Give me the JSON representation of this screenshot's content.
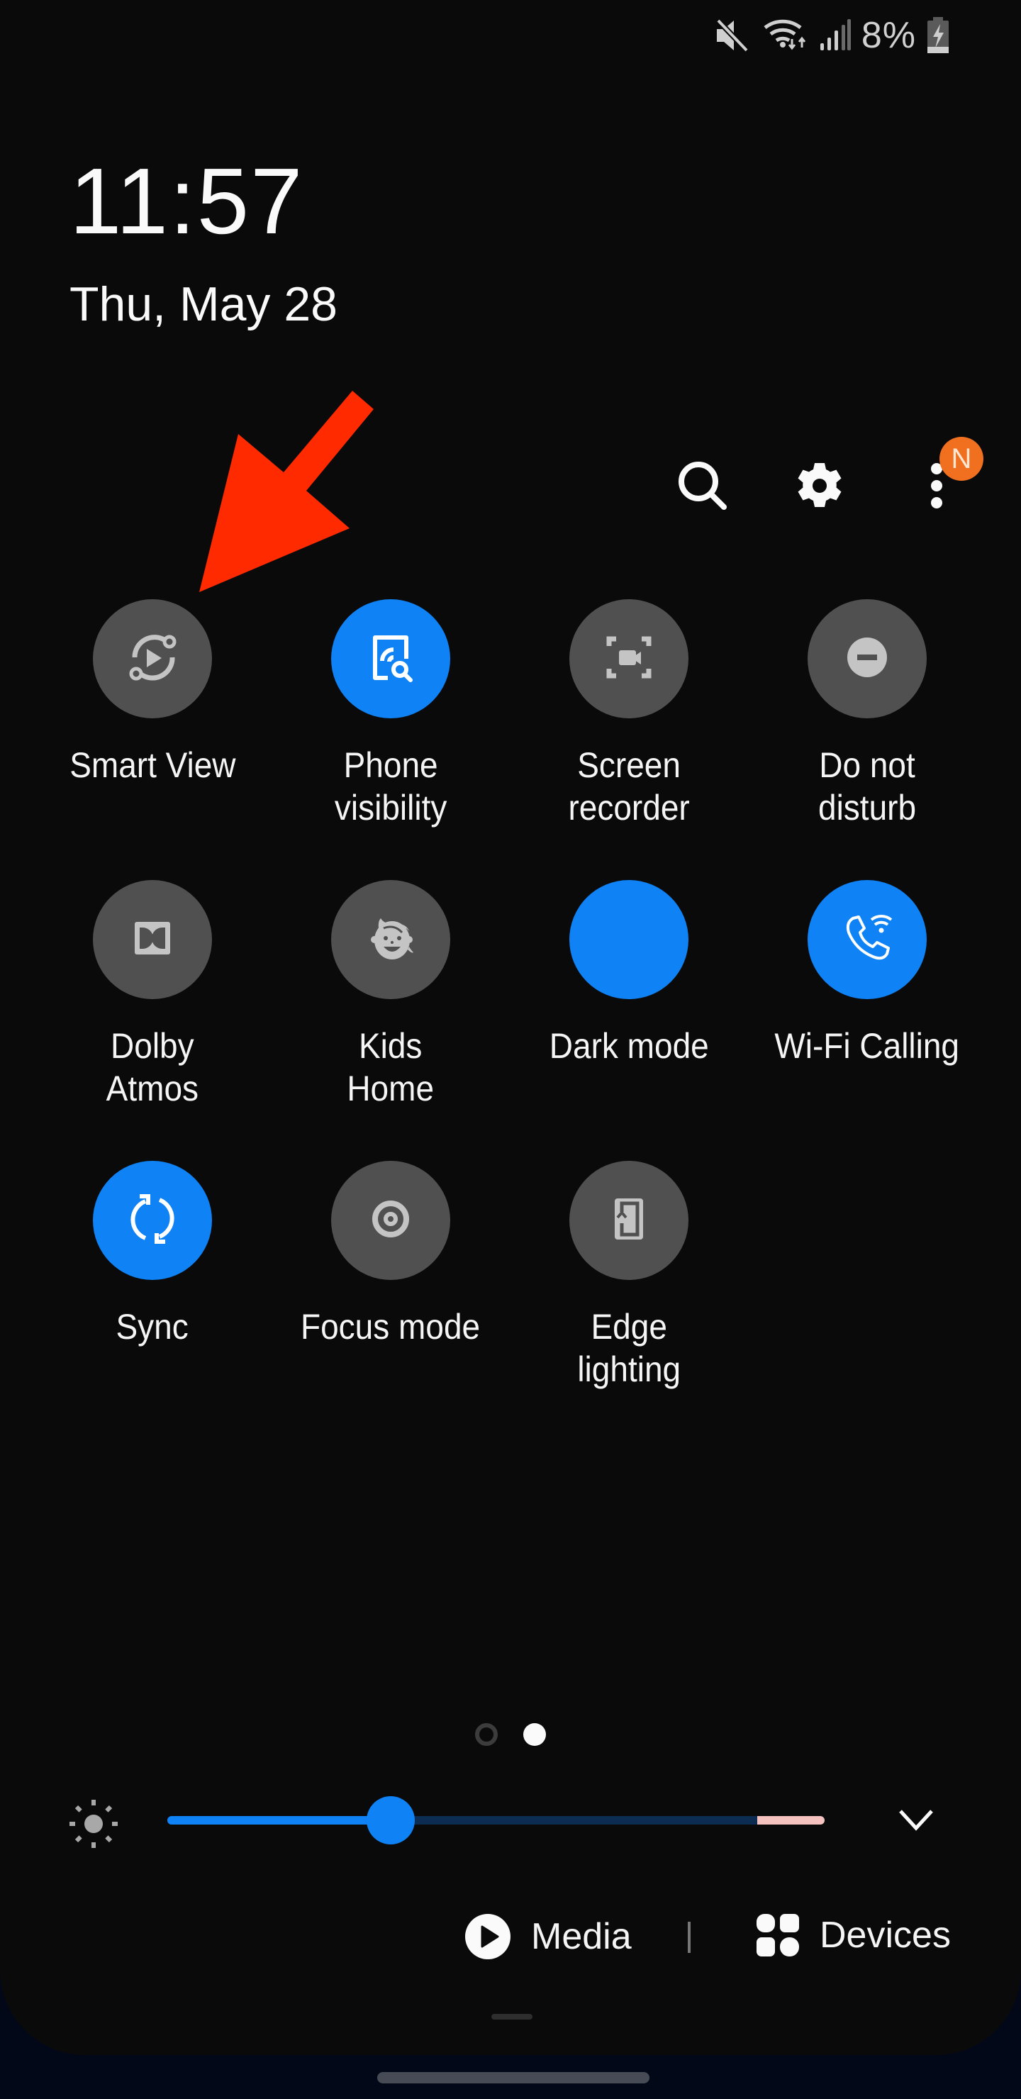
{
  "status_bar": {
    "icons": [
      "mute-icon",
      "wifi-data-icon",
      "cell-signal-icon",
      "battery-charging-icon"
    ],
    "battery_percent": "8%"
  },
  "clock": {
    "time": "11:57",
    "date": "Thu, May 28"
  },
  "top_actions": {
    "search_icon": "search-icon",
    "settings_icon": "gear-icon",
    "more_icon": "more-vertical-icon",
    "notification_badge": "N"
  },
  "annotation": {
    "type": "arrow",
    "color": "#ff2a00",
    "points_to": "Smart View"
  },
  "quick_tiles": [
    {
      "label": "Smart View",
      "icon": "smart-view-icon",
      "active": false
    },
    {
      "label": "Phone\nvisibility",
      "icon": "phone-visibility-icon",
      "active": true
    },
    {
      "label": "Screen\nrecorder",
      "icon": "screen-recorder-icon",
      "active": false
    },
    {
      "label": "Do not\ndisturb",
      "icon": "do-not-disturb-icon",
      "active": false
    },
    {
      "label": "Dolby\nAtmos",
      "icon": "dolby-icon",
      "active": false
    },
    {
      "label": "Kids\nHome",
      "icon": "kids-face-icon",
      "active": false
    },
    {
      "label": "Dark mode",
      "icon": "moon-icon",
      "active": true
    },
    {
      "label": "Wi-Fi Calling",
      "icon": "wifi-calling-icon",
      "active": true
    },
    {
      "label": "Sync",
      "icon": "sync-icon",
      "active": true
    },
    {
      "label": "Focus mode",
      "icon": "focus-target-icon",
      "active": false
    },
    {
      "label": "Edge\nlighting",
      "icon": "edge-lighting-icon",
      "active": false
    }
  ],
  "pager": {
    "page_count": 2,
    "current_page": 2
  },
  "brightness": {
    "level": 0.34,
    "icon": "sun-icon",
    "expand_icon": "chevron-down-icon"
  },
  "bottom_bar": {
    "media_label": "Media",
    "devices_label": "Devices"
  },
  "colors": {
    "accent": "#0f82f5",
    "tile_off": "#505050",
    "icon_off": "#c4c4c4",
    "badge": "#f07020",
    "panel_bg": "#0a0a0a"
  }
}
